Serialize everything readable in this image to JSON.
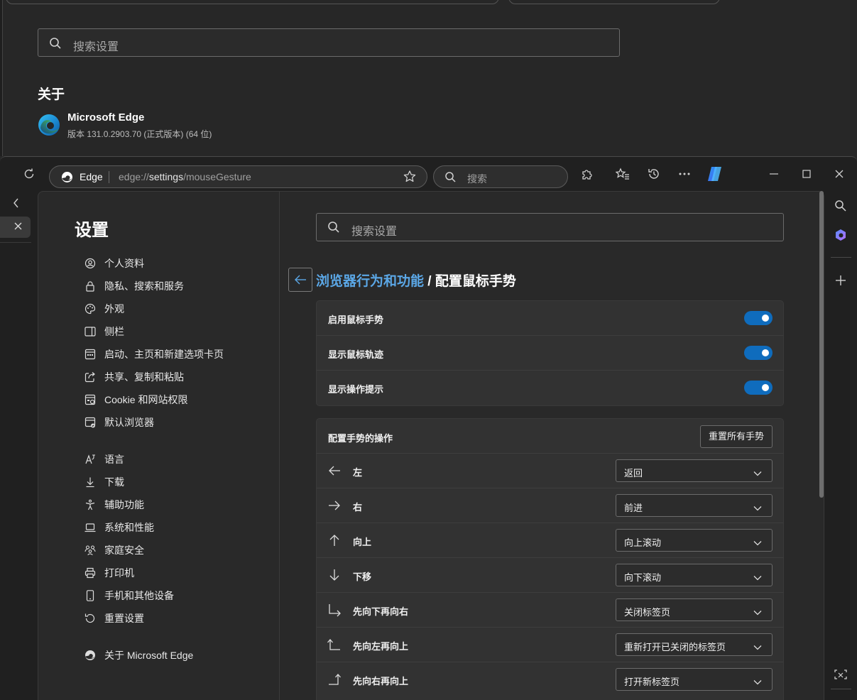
{
  "background_window": {
    "search_placeholder": "搜索设置",
    "section_title": "关于",
    "product_name": "Microsoft Edge",
    "version": "版本 131.0.2903.70 (正式版本) (64 位)"
  },
  "toolbar": {
    "site_label": "Edge",
    "url_prefix": "edge://",
    "url_host": "settings",
    "url_path": "/mouseGesture",
    "search_placeholder": "搜索"
  },
  "settings_nav": {
    "title": "设置",
    "items": [
      {
        "label": "个人资料",
        "icon": "profile-icon"
      },
      {
        "label": "隐私、搜索和服务",
        "icon": "lock-icon"
      },
      {
        "label": "外观",
        "icon": "palette-icon"
      },
      {
        "label": "侧栏",
        "icon": "sidebar-icon"
      },
      {
        "label": "启动、主页和新建选项卡页",
        "icon": "home-grid-icon"
      },
      {
        "label": "共享、复制和粘贴",
        "icon": "share-icon"
      },
      {
        "label": "Cookie 和网站权限",
        "icon": "site-permissions-icon"
      },
      {
        "label": "默认浏览器",
        "icon": "default-browser-icon"
      },
      {
        "label": "语言",
        "icon": "language-icon"
      },
      {
        "label": "下载",
        "icon": "download-icon"
      },
      {
        "label": "辅助功能",
        "icon": "accessibility-icon"
      },
      {
        "label": "系统和性能",
        "icon": "laptop-icon"
      },
      {
        "label": "家庭安全",
        "icon": "family-icon"
      },
      {
        "label": "打印机",
        "icon": "printer-icon"
      },
      {
        "label": "手机和其他设备",
        "icon": "phone-icon"
      },
      {
        "label": "重置设置",
        "icon": "reset-icon"
      },
      {
        "label": "关于 Microsoft Edge",
        "icon": "edge-icon"
      }
    ]
  },
  "main": {
    "search_placeholder": "搜索设置",
    "breadcrumb_parent": "浏览器行为和功能",
    "breadcrumb_sep": " / ",
    "breadcrumb_current": "配置鼠标手势",
    "toggles": [
      {
        "label": "启用鼠标手势",
        "on": true
      },
      {
        "label": "显示鼠标轨迹",
        "on": true
      },
      {
        "label": "显示操作提示",
        "on": true
      }
    ],
    "gestures_header": "配置手势的操作",
    "reset_all_label": "重置所有手势",
    "gestures": [
      {
        "label": "左",
        "action": "返回",
        "icon": "arrow-left-icon"
      },
      {
        "label": "右",
        "action": "前进",
        "icon": "arrow-right-icon"
      },
      {
        "label": "向上",
        "action": "向上滚动",
        "icon": "arrow-up-icon"
      },
      {
        "label": "下移",
        "action": "向下滚动",
        "icon": "arrow-down-icon"
      },
      {
        "label": "先向下再向右",
        "action": "关闭标签页",
        "icon": "down-then-right-icon"
      },
      {
        "label": "先向左再向上",
        "action": "重新打开已关闭的标签页",
        "icon": "left-then-up-icon"
      },
      {
        "label": "先向右再向上",
        "action": "打开新标签页",
        "icon": "right-then-up-icon"
      }
    ]
  },
  "colors": {
    "accent": "#0f6cbd",
    "link": "#5ba7e6"
  }
}
